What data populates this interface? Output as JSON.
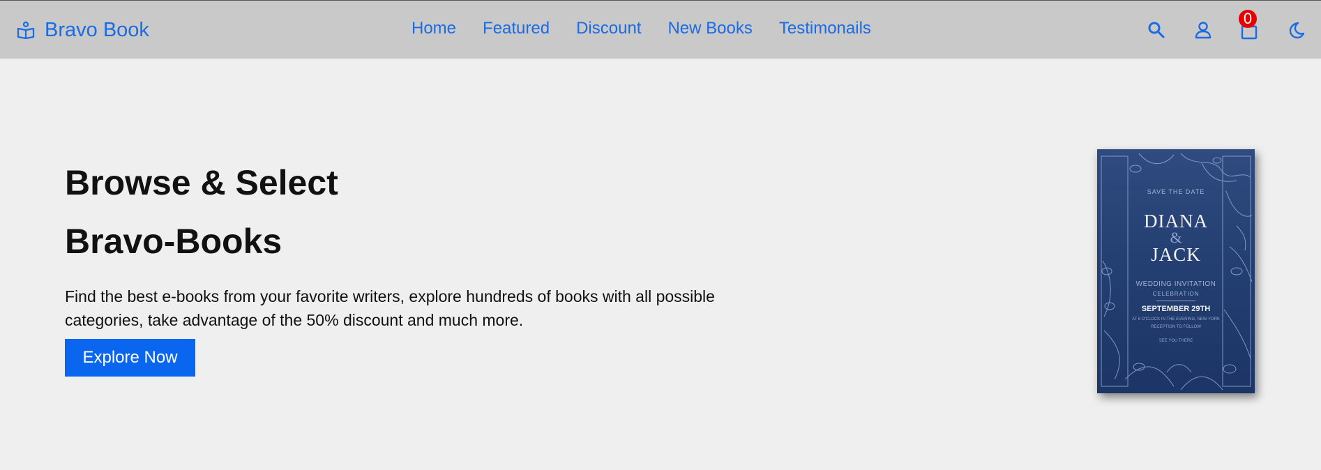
{
  "brand": {
    "name": "Bravo Book",
    "icon": "book-reader-icon",
    "color": "#1a6be6"
  },
  "nav": {
    "items": [
      {
        "label": "Home"
      },
      {
        "label": "Featured"
      },
      {
        "label": "Discount"
      },
      {
        "label": "New Books"
      },
      {
        "label": "Testimonails"
      }
    ]
  },
  "header_icons": {
    "search": "search-icon",
    "user": "user-icon",
    "cart": "cart-icon",
    "theme": "moon-icon",
    "cart_count": "0"
  },
  "hero": {
    "title_line1": "Browse & Select",
    "title_line2": "Bravo-Books",
    "description": "Find the best e-books from your favorite writers, explore hundreds of books with all possible categories, take advantage of the 50% discount and much more.",
    "button_label": "Explore Now",
    "button_color": "#0a66ee"
  },
  "cover": {
    "save_the_date": "SAVE THE DATE",
    "name1": "DIANA",
    "amp": "&",
    "name2": "JACK",
    "invitation": "WEDDING INVITATION",
    "celebration": "CELEBRATION",
    "date": "SEPTEMBER 29TH",
    "detail": "AT 6 O'CLOCK IN THE EVENING, NEW YORK",
    "reception": "RECEPTION TO FOLLOW",
    "see_you": "SEE YOU THERE"
  },
  "colors": {
    "header_bg": "#c9c9c9",
    "page_bg": "#efefef",
    "badge": "#e60000",
    "cover_bg": "#243f72"
  }
}
